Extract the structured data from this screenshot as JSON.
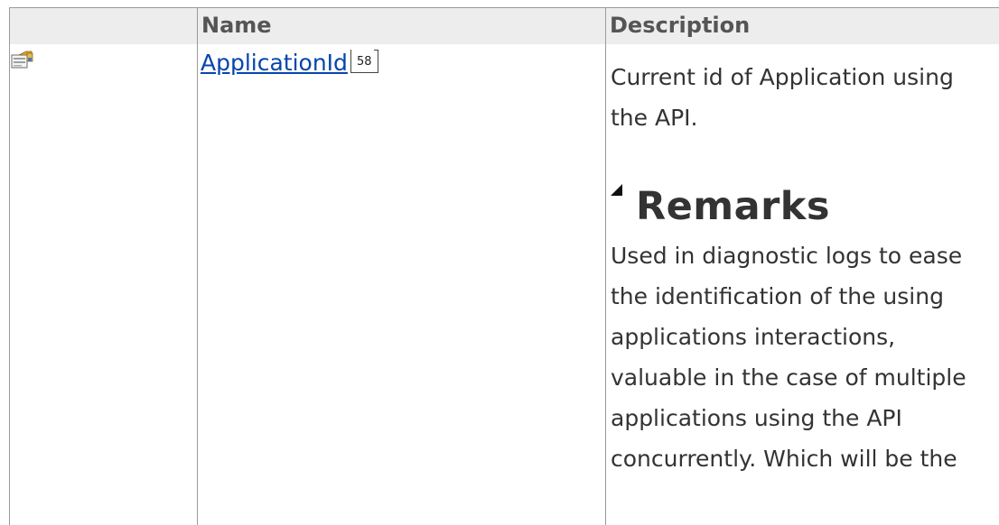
{
  "table": {
    "headers": {
      "icon": "",
      "name": "Name",
      "description": "Description"
    },
    "rows": [
      {
        "icon": "property-icon",
        "name": "ApplicationId",
        "page_ref": "58",
        "description": "Current id of Application using the API.",
        "remarks_heading": "Remarks",
        "remarks": "Used in diagnostic logs to ease the identification of the using applications interactions, valuable in the case of multiple applications using the API concurrently. Which will be the"
      }
    ]
  },
  "colors": {
    "header_bg": "#ededed",
    "grid": "#9a9a9a",
    "link": "#0645ad",
    "text": "#333333"
  }
}
